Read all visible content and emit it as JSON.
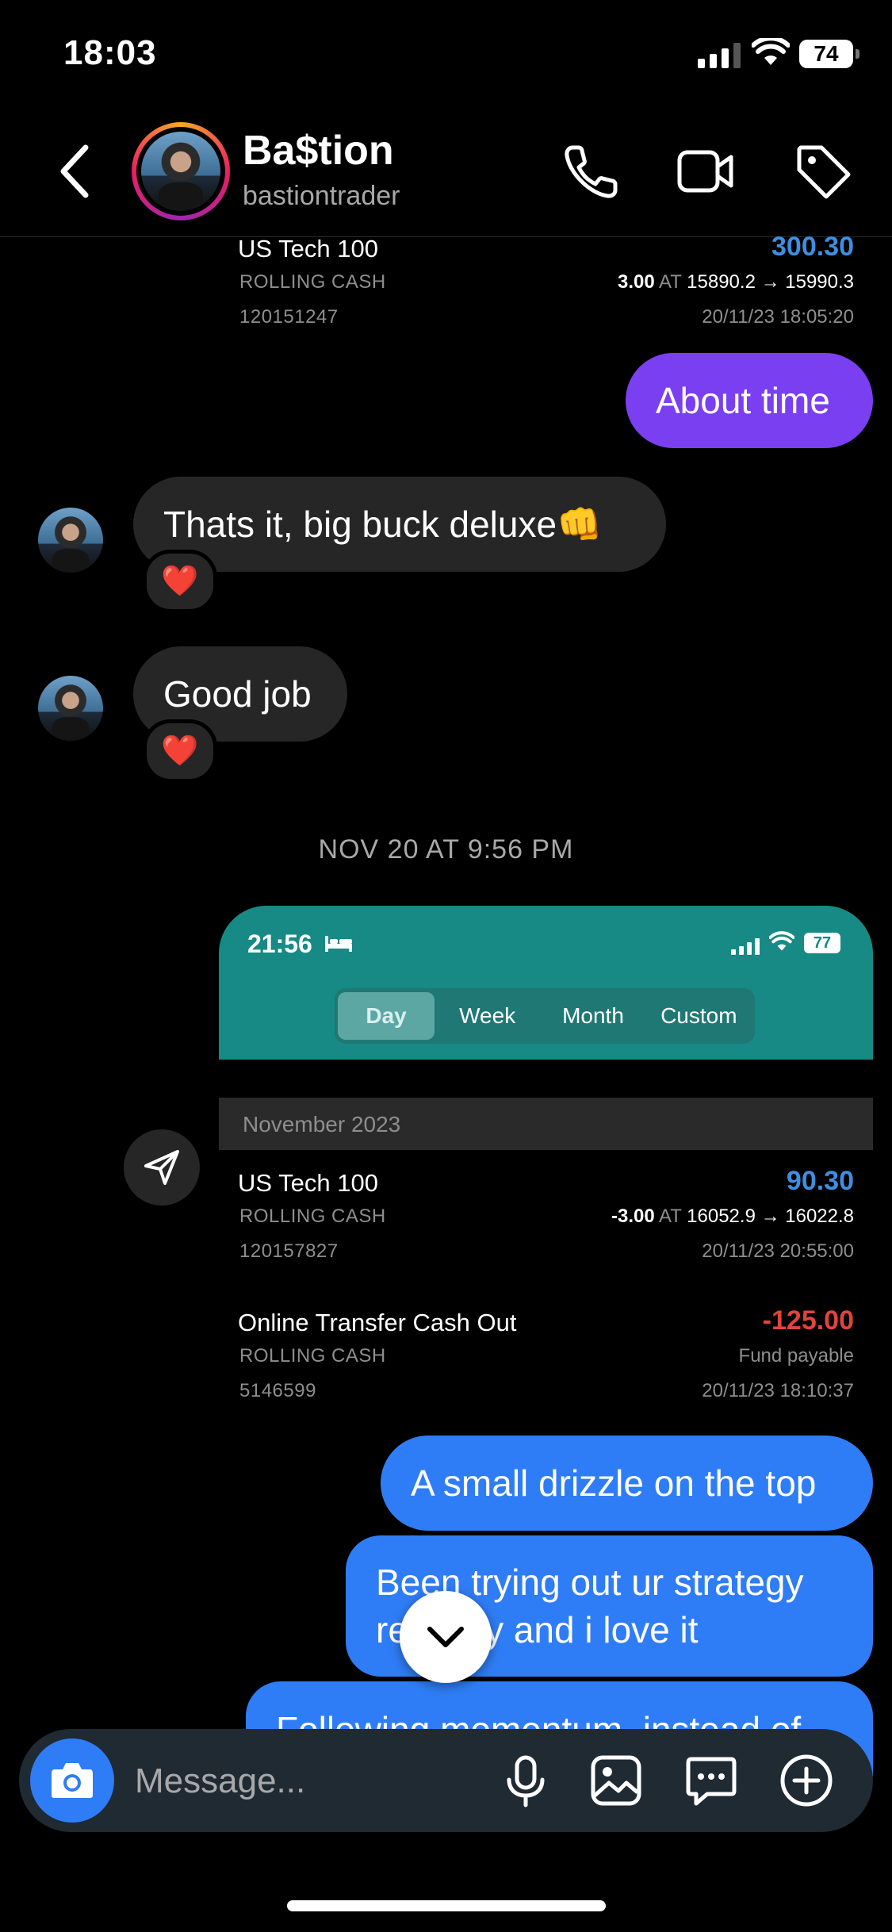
{
  "status_bar": {
    "time": "18:03",
    "battery": "74"
  },
  "header": {
    "name": "Ba$tion",
    "username": "bastiontrader"
  },
  "transactions_top": [
    {
      "name": "US Tech 100",
      "type": "ROLLING CASH",
      "id": "120151247",
      "amount": "300.30",
      "qty": "3.00",
      "at": "AT",
      "detail": "15890.2 → 15990.3",
      "date": "20/11/23 18:05:20"
    }
  ],
  "messages": {
    "about_time": "About time",
    "big_buck": "Thats it, big buck deluxe👊",
    "good_job": "Good job",
    "reaction": "❤️",
    "timestamp": "NOV 20 AT 9:56 PM",
    "drizzle": "A small drizzle on the top",
    "strategy_line1": "Been trying out ur strategy",
    "strategy_line2": "recently and i love it",
    "momentum": "Following momentum, instead of"
  },
  "shared_screenshot": {
    "time": "21:56",
    "battery": "77",
    "tabs": [
      "Day",
      "Week",
      "Month",
      "Custom"
    ],
    "month": "November 2023",
    "rows": [
      {
        "name": "US Tech 100",
        "type": "ROLLING CASH",
        "id": "120157827",
        "amount": "90.30",
        "qty": "-3.00",
        "at": "AT",
        "detail": "16052.9 → 16022.8",
        "date": "20/11/23 20:55:00"
      },
      {
        "name": "Online Transfer Cash Out",
        "type": "ROLLING CASH",
        "id": "5146599",
        "amount": "-125.00",
        "note": "Fund payable",
        "date": "20/11/23 18:10:37"
      }
    ]
  },
  "composer": {
    "placeholder": "Message..."
  },
  "colors": {
    "sent_purple": "#7a3ff0",
    "sent_blue": "#2f7df6",
    "received": "#262626",
    "positive": "#3f8ee0",
    "negative": "#e0443f",
    "screenshot_teal": "#178a85"
  }
}
